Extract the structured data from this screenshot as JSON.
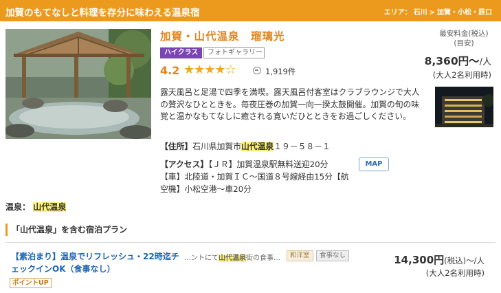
{
  "header": {
    "catchcopy": "加賀のもてなしと料理を存分に味わえる温泉宿",
    "breadcrumb": [
      "エリア：",
      "石川",
      ">",
      "加賀・小松・辰口"
    ]
  },
  "hotel": {
    "name": "加賀・山代温泉　瑠璃光",
    "badge_class": "ハイクラス",
    "badge_gallery": "フォトギャラリー",
    "rating": "4.2",
    "stars_filled": 4,
    "stars_total": 5,
    "review_count": "1,919件",
    "description": "露天風呂と足湯で四季を満喫。露天風呂付客室はクラブラウンジで大人の贅沢なひとときを。毎夜圧巻の加賀一向一揆太鼓開催。加賀の旬の味覚と温かなもてなしに癒される寛いだひとときをお過ごしください。",
    "address_label": "【住所】",
    "address_pre": "石川県加賀市",
    "address_highlight": "山代温泉",
    "address_post": "１９－５８－１",
    "access_label": "【アクセス】",
    "access_text": "【ＪＲ】加賀温泉駅無料送迎20分",
    "car_text_1": "【車】北陸道・加賀ＩＣ～国道８号線経由15分【航",
    "car_text_2": "空機】小松空港～車20分",
    "map_button": "MAP"
  },
  "price": {
    "label_line1": "最安料金(税込)",
    "label_line2": "(目安)",
    "amount": "8,360円～",
    "unit": "/人",
    "note": "(大人2名利用時)"
  },
  "onsen": {
    "label": "温泉：",
    "value": "山代温泉"
  },
  "plans_section": {
    "heading": "「山代温泉」を含む宿泊プラン"
  },
  "plan": {
    "title": "【素泊まり】温泉でリフレッシュ・22時迄チェックインOK（食事なし）",
    "point_badge": "ポイントUP",
    "snippet_pre": "…ントにて",
    "snippet_highlight": "山代温泉",
    "snippet_post": "街の食事…",
    "tag1": "和洋室",
    "tag2": "食事なし",
    "price": "14,300円",
    "price_suffix": "(税込)～/人",
    "note": "(大人2名利用時)"
  },
  "colors": {
    "accent": "#ec9a1e",
    "name": "#e3851b",
    "link": "#1c64b4",
    "badge": "#7a43b6",
    "highlight": "#fff27a"
  },
  "icons": {
    "star": "star-icon",
    "review": "review-bubble-icon"
  }
}
